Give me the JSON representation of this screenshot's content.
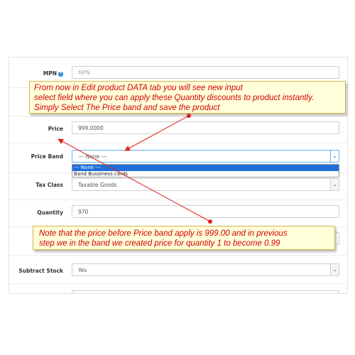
{
  "form": {
    "mpn": {
      "label": "MPN",
      "placeholder": "MPN"
    },
    "price": {
      "label": "Price",
      "value": "999.0000"
    },
    "price_band": {
      "label": "Price Band",
      "selected": "--- None ---",
      "options": [
        "--- None ---",
        "Band Bussiness cards"
      ]
    },
    "tax_class": {
      "label": "Tax Class",
      "selected": "Taxable Goods"
    },
    "quantity": {
      "label": "Quantity",
      "value": "970"
    },
    "subtract_stock": {
      "label": "Subtract Stock",
      "selected": "Yes"
    }
  },
  "notes": {
    "top": [
      "From now in Edit product DATA tab you will see new input",
      "select field where you can apply these Quantity discounts to product instantly.",
      "Simply Select The Price band and save the product"
    ],
    "bottom": [
      "Note that the price before Price band apply is 999.00 and in previous",
      "step we in the band we created price for quantity 1 to become 0.99"
    ]
  },
  "colors": {
    "note_text": "#d40000",
    "note_bg": "#ffffd9",
    "arrow": "#e02020",
    "selected_option": "#1e6fd9"
  }
}
